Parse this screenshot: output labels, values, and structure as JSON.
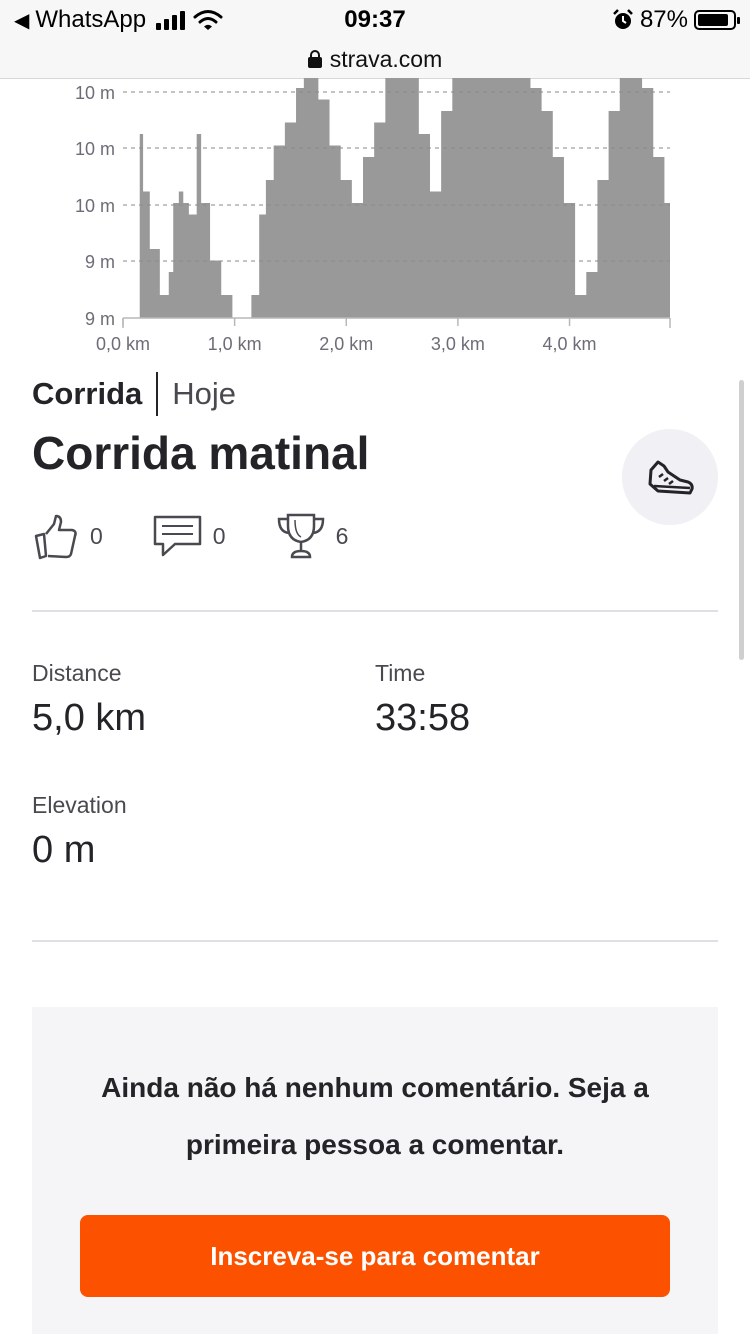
{
  "status_bar": {
    "back_app": "WhatsApp",
    "time": "09:37",
    "battery_percent": "87%",
    "battery_level": 0.87,
    "signal_bars": 4
  },
  "browser": {
    "url": "strava.com"
  },
  "chart_data": {
    "type": "area",
    "xlabel": "",
    "ylabel": "",
    "x_ticks": [
      "0,0 km",
      "1,0 km",
      "2,0 km",
      "3,0 km",
      "4,0 km"
    ],
    "y_ticks": [
      "10 m",
      "10 m",
      "10 m",
      "9 m",
      "9 m"
    ],
    "x_range_km": [
      0,
      4.9
    ],
    "y_range_m": [
      9,
      10
    ],
    "grid": true,
    "color": "#999999",
    "series": [
      {
        "x": [
          0.15,
          0.18,
          0.24,
          0.33,
          0.41,
          0.45,
          0.5,
          0.54,
          0.59,
          0.66,
          0.7,
          0.78,
          0.88,
          0.98,
          1.05,
          1.15,
          1.22,
          1.28,
          1.35,
          1.45,
          1.55,
          1.62,
          1.67,
          1.75,
          1.85,
          1.95,
          2.05,
          2.15,
          2.25,
          2.35,
          2.45,
          2.55,
          2.65,
          2.75,
          2.85,
          2.95,
          3.05,
          3.15,
          3.25,
          3.35,
          3.45,
          3.55,
          3.65,
          3.75,
          3.85,
          3.95,
          4.05,
          4.15,
          4.25,
          4.35,
          4.45,
          4.55,
          4.65,
          4.75,
          4.85,
          4.9
        ],
        "y": [
          9.8,
          9.55,
          9.3,
          9.1,
          9.2,
          9.5,
          9.55,
          9.5,
          9.45,
          9.8,
          9.5,
          9.25,
          9.1,
          9.0,
          9.0,
          9.1,
          9.45,
          9.6,
          9.75,
          9.85,
          10.0,
          10.2,
          10.1,
          9.95,
          9.75,
          9.6,
          9.5,
          9.7,
          9.85,
          10.05,
          10.15,
          10.05,
          9.8,
          9.55,
          9.9,
          10.25,
          10.4,
          10.4,
          10.4,
          10.4,
          10.35,
          10.25,
          10.0,
          9.9,
          9.7,
          9.5,
          9.1,
          9.2,
          9.6,
          9.9,
          10.1,
          10.15,
          10.0,
          9.7,
          9.5,
          9.8
        ]
      }
    ]
  },
  "activity": {
    "kind": "Corrida",
    "when": "Hoje",
    "title": "Corrida matinal",
    "sport_icon": "running-shoe-icon",
    "kudos": "0",
    "comments": "0",
    "achievements": "6"
  },
  "stats": {
    "distance": {
      "label": "Distance",
      "value": "5,0 km"
    },
    "time": {
      "label": "Time",
      "value": "33:58"
    },
    "elevation": {
      "label": "Elevation",
      "value": "0 m"
    }
  },
  "comments_section": {
    "empty_message": "Ainda não há nenhum comentário. Seja a primeira pessoa a comentar.",
    "signup_button": "Inscreva-se para comentar"
  },
  "colors": {
    "accent": "#fc5200",
    "chart_fill": "#999999",
    "panel_bg": "#f5f5f7"
  }
}
